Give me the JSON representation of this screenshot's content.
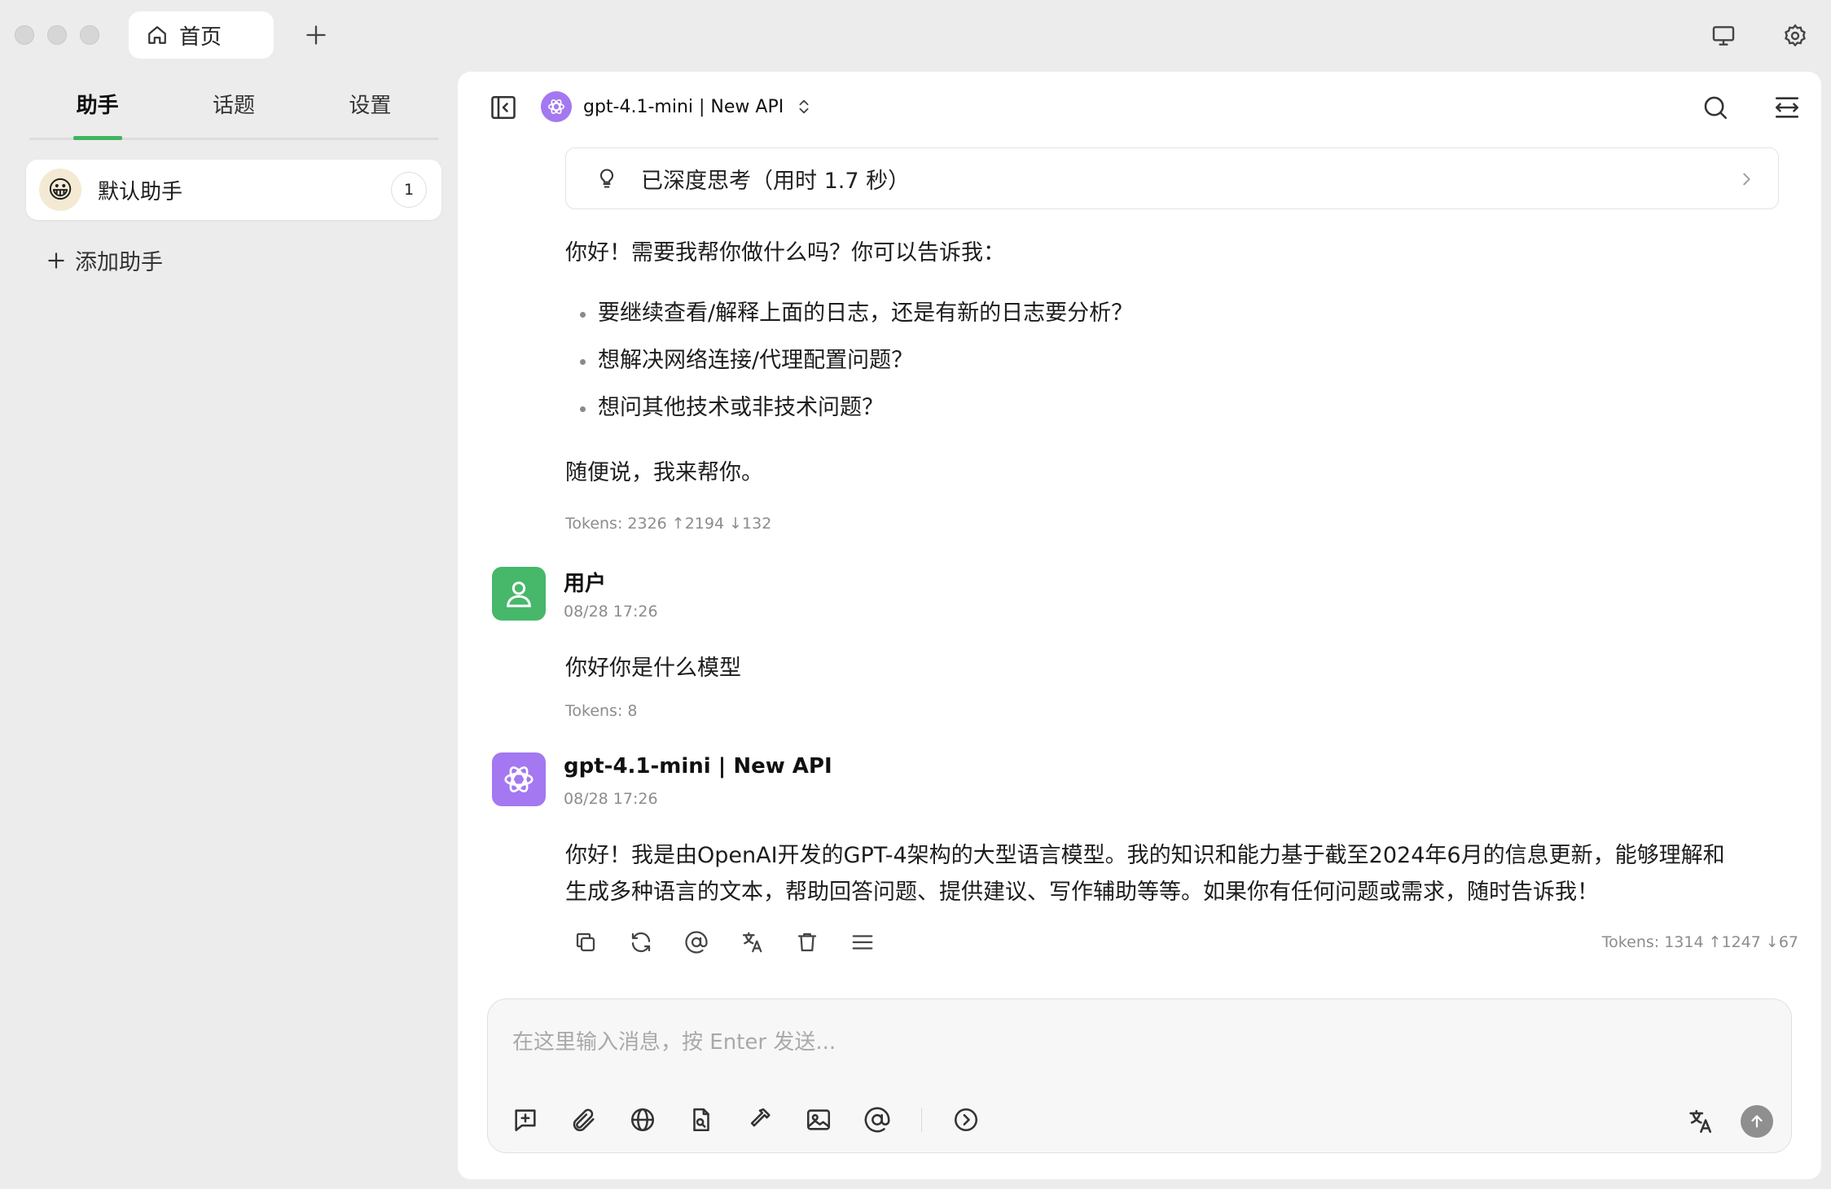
{
  "titlebar": {
    "home_tab_label": "首页"
  },
  "sidebar": {
    "tabs": [
      {
        "label": "助手"
      },
      {
        "label": "话题"
      },
      {
        "label": "设置"
      }
    ],
    "assistant": {
      "avatar_emoji": "😀",
      "name": "默认助手",
      "count": "1"
    },
    "add_assistant_label": "添加助手"
  },
  "header": {
    "model_name": "gpt-4.1-mini | New API"
  },
  "messages": {
    "thinking_label": "已深度思考（用时 1.7 秒）",
    "assistant_prev": {
      "greeting": "你好！需要我帮你做什么吗？你可以告诉我：",
      "bullets": [
        "要继续查看/解释上面的日志，还是有新的日志要分析？",
        "想解决网络连接/代理配置问题？",
        "想问其他技术或非技术问题？"
      ],
      "closing": "随便说，我来帮你。",
      "tokens": "Tokens: 2326 ↑2194 ↓132"
    },
    "user": {
      "name": "用户",
      "time": "08/28 17:26",
      "text": "你好你是什么模型",
      "tokens": "Tokens: 8"
    },
    "assistant": {
      "name": "gpt-4.1-mini | New API",
      "time": "08/28 17:26",
      "line1": "你好！我是由OpenAI开发的GPT-4架构的大型语言模型。我的知识和能力基于截至2024年6月的信息更新，能够理解和",
      "line2": "生成多种语言的文本，帮助回答问题、提供建议、写作辅助等等。如果你有任何问题或需求，随时告诉我！",
      "tokens": "Tokens: 1314 ↑1247 ↓67"
    }
  },
  "input": {
    "placeholder": "在这里输入消息，按 Enter 发送..."
  },
  "colors": {
    "accent_green": "#3fb560",
    "user_avatar": "#47b76a",
    "model_avatar": "#a478f0"
  }
}
